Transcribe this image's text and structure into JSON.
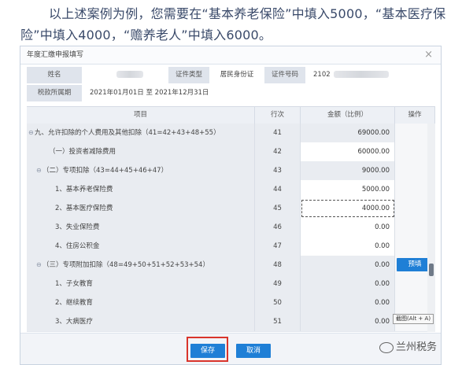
{
  "intro_text": "以上述案例为例，您需要在“基本养老保险”中填入5000，“基本医疗保险”中填入4000，“赡养老人”中填入6000。",
  "dialog": {
    "title": "年度汇缴申报填写",
    "close_glyph": "×",
    "name_label": "姓名",
    "id_type_label": "证件类型",
    "id_type_value": "居民身份证",
    "id_number_label": "证件号码",
    "id_number_prefix": "2102",
    "period_label": "税款所属期",
    "period_value": "2021年01月01日 至 2021年12月31日",
    "headers": {
      "item": "项目",
      "line_no": "行次",
      "amount": "金额（比例）",
      "action": "操作"
    },
    "rows": [
      {
        "item": "九、允许扣除的个人费用及其他扣除（41=42+43+48+55）",
        "line_no": "41",
        "amount": "69000.00"
      },
      {
        "item": "（一）投资者减除费用",
        "line_no": "42",
        "amount": "60000.00"
      },
      {
        "item": "（二）专项扣除（43=44+45+46+47）",
        "line_no": "43",
        "amount": "9000.00"
      },
      {
        "item": "1、基本养老保险费",
        "line_no": "44",
        "amount": "5000.00"
      },
      {
        "item": "2、基本医疗保险费",
        "line_no": "45",
        "amount": "4000.00"
      },
      {
        "item": "3、失业保险费",
        "line_no": "46",
        "amount": "0.00"
      },
      {
        "item": "4、住房公积金",
        "line_no": "47",
        "amount": "0.00"
      },
      {
        "item": "（三）专项附加扣除（48=49+50+51+52+53+54）",
        "line_no": "48",
        "amount": "0.00",
        "action": "预填"
      },
      {
        "item": "1、子女教育",
        "line_no": "49",
        "amount": "0.00"
      },
      {
        "item": "2、继续教育",
        "line_no": "50",
        "amount": "0.00"
      },
      {
        "item": "3、大病医疗",
        "line_no": "51",
        "amount": "0.00"
      }
    ],
    "tooltip": "截图(Alt + A)",
    "save_label": "保存",
    "cancel_label": "取消"
  },
  "watermark": "兰州税务",
  "colors": {
    "accent": "#1f7fd6",
    "highlight": "#d9342b",
    "intro_text": "#3a4a6a"
  }
}
